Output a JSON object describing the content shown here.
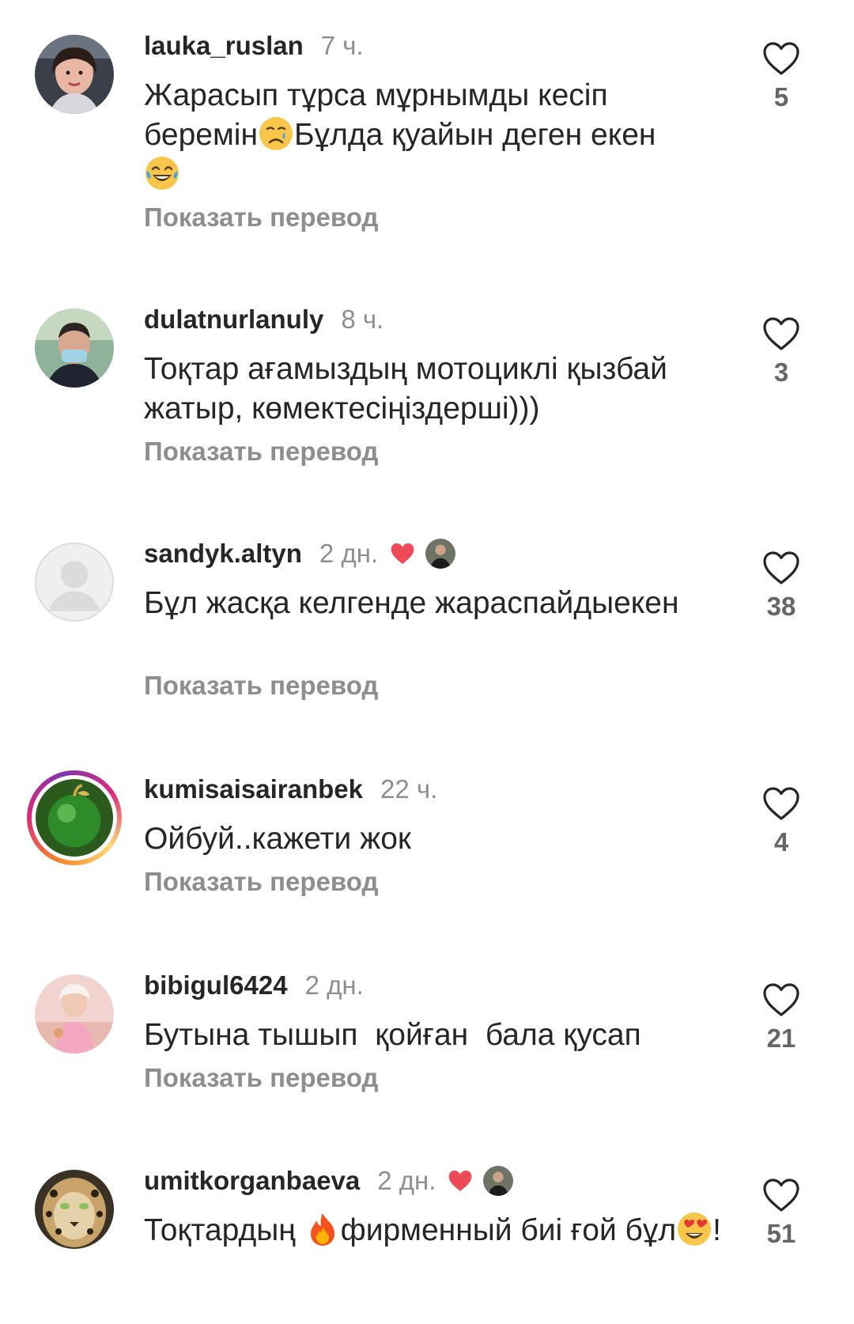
{
  "comments": [
    {
      "username": "lauka_ruslan",
      "time": "7 ч.",
      "text_parts": [
        "Жарасып тұрса мұрнымды кесіп беремін",
        "Бұлда қуайын деген екен"
      ],
      "emojis": [
        "crying-face",
        "tears-of-joy-face"
      ],
      "translate": "Показать перевод",
      "likes": "5",
      "author_liked": false
    },
    {
      "username": "dulatnurlanuly",
      "time": "8 ч.",
      "text": "Тоқтар ағамыздың мотоциклі қызбай жатыр, көмектесіңіздерші)))",
      "translate": "Показать перевод",
      "likes": "3",
      "author_liked": false
    },
    {
      "username": "sandyk.altyn",
      "time": "2 дн.",
      "text": "Бұл жасқа келгенде жараспайдыекен",
      "translate": "Показать перевод",
      "likes": "38",
      "author_liked": true
    },
    {
      "username": "kumisaisairanbek",
      "time": "22 ч.",
      "text": "Ойбуй..кажети жок",
      "translate": "Показать перевод",
      "likes": "4",
      "author_liked": false,
      "has_story": true
    },
    {
      "username": "bibigul6424",
      "time": "2 дн.",
      "text": "Бутына тышып  қойған  бала қусап",
      "translate": "Показать перевод",
      "likes": "21",
      "author_liked": false
    },
    {
      "username": "umitkorganbaeva",
      "time": "2 дн.",
      "text_parts": [
        "Тоқтардың ",
        "фирменный биі ғой бұл",
        "!"
      ],
      "emojis": [
        "fire",
        "heart-eyes-face"
      ],
      "likes": "51",
      "author_liked": true
    }
  ],
  "colors": {
    "text": "#262626",
    "secondary": "#8e8e8e",
    "like_red": "#ed4956"
  },
  "icons": {
    "like": "heart-outline-icon",
    "author_like": "heart-filled-icon"
  }
}
